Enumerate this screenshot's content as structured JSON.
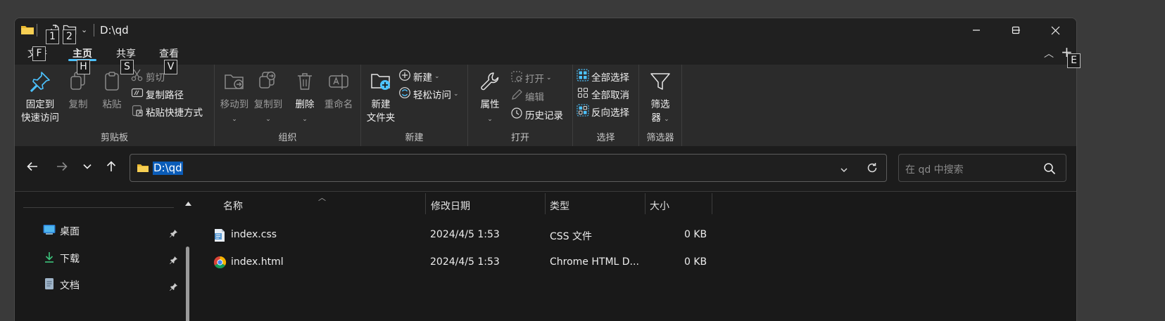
{
  "window": {
    "title": "D:\\qd"
  },
  "keytips": {
    "qat1": "1",
    "qat2": "2",
    "file": "F",
    "home": "H",
    "share": "S",
    "view": "V",
    "expand": "E"
  },
  "tabs": {
    "file": "文件",
    "home": "主页",
    "share": "共享",
    "view": "查看"
  },
  "ribbon": {
    "clipboard": {
      "label": "剪贴板",
      "pin": "固定到\n快速访问",
      "pin_l1": "固定到",
      "pin_l2": "快速访问",
      "copy": "复制",
      "paste": "粘贴",
      "cut": "剪切",
      "copy_path": "复制路径",
      "paste_shortcut": "粘贴快捷方式"
    },
    "organize": {
      "label": "组织",
      "move_to": "移动到",
      "copy_to": "复制到",
      "delete": "删除",
      "rename": "重命名"
    },
    "new": {
      "label": "新建",
      "new_folder_l1": "新建",
      "new_folder_l2": "文件夹",
      "new_item": "新建",
      "easy_access": "轻松访问"
    },
    "open": {
      "label": "打开",
      "properties": "属性",
      "open": "打开",
      "edit": "编辑",
      "history": "历史记录"
    },
    "select": {
      "label": "选择",
      "select_all": "全部选择",
      "select_none": "全部取消",
      "invert": "反向选择"
    },
    "filter": {
      "label": "筛选器",
      "filter_l1": "筛选",
      "filter_l2": "器"
    }
  },
  "address": {
    "path": "D:\\qd"
  },
  "search": {
    "placeholder": "在 qd 中搜索"
  },
  "nav": {
    "items": [
      {
        "label": "桌面",
        "icon": "desktop-icon"
      },
      {
        "label": "下载",
        "icon": "download-icon"
      },
      {
        "label": "文档",
        "icon": "document-icon"
      }
    ]
  },
  "columns": {
    "name": "名称",
    "modified": "修改日期",
    "type": "类型",
    "size": "大小"
  },
  "files": [
    {
      "name": "index.css",
      "modified": "2024/4/5 1:53",
      "type": "CSS 文件",
      "size": "0 KB",
      "icon": "css-file-icon"
    },
    {
      "name": "index.html",
      "modified": "2024/4/5 1:53",
      "type": "Chrome HTML D...",
      "size": "0 KB",
      "icon": "chrome-icon"
    }
  ],
  "colors": {
    "accent": "#4cc2ff",
    "folder": "#f0c040",
    "selection": "#0a5cb8"
  }
}
